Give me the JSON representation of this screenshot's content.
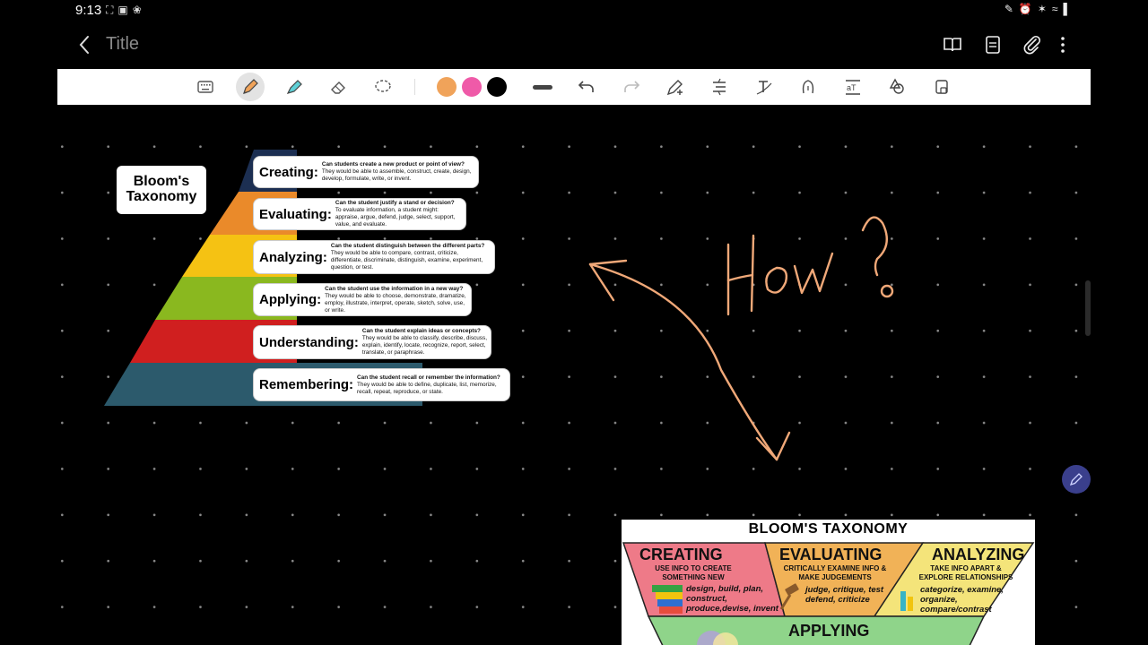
{
  "status": {
    "time": "9:13",
    "left_icons": [
      "⛶",
      "▣",
      "❀"
    ],
    "right_icons": [
      "✎",
      "⏰",
      "✶",
      "≈",
      "▌"
    ]
  },
  "app_bar": {
    "title": "Title",
    "actions": [
      "book-icon",
      "page-view-icon",
      "attach-icon",
      "more-icon"
    ]
  },
  "toolbar": {
    "tools": [
      "keyboard-icon",
      "pen-icon",
      "highlighter-icon",
      "eraser-icon",
      "lasso-icon"
    ],
    "colors": [
      "#f0a35a",
      "#ef5aa8",
      "#000000"
    ],
    "selected_tool": "pen-icon"
  },
  "pyramid": {
    "title_line1": "Bloom's",
    "title_line2": "Taxonomy",
    "levels": [
      {
        "name": "Creating:",
        "color": "#1c2f52",
        "question": "Can students create a new product or point of view?",
        "desc": "They would be able to assemble, construct, create, design, develop, formulate, write, or invent."
      },
      {
        "name": "Evaluating:",
        "color": "#ea8a2a",
        "question": "Can the student justify a stand or decision?",
        "desc": "To evaluate information, a student might: appraise, argue, defend, judge, select, support, value, and evaluate."
      },
      {
        "name": "Analyzing:",
        "color": "#f5c213",
        "question": "Can the student distinguish between the different parts?",
        "desc": "They would be able to compare, contrast, criticize, differentiate, discriminate, distinguish, examine, experiment, question, or test."
      },
      {
        "name": "Applying:",
        "color": "#8ab81f",
        "question": "Can the student use the information in a new way?",
        "desc": "They would be able to choose, demonstrate, dramatize, employ, illustrate, interpret, operate, sketch, solve, use, or write."
      },
      {
        "name": "Understanding:",
        "color": "#d01f1f",
        "question": "Can the student explain ideas or concepts?",
        "desc": "They would be able to classify, describe, discuss, explain, identify, locate, recognize, report, select, translate, or paraphrase."
      },
      {
        "name": "Remembering:",
        "color": "#2c5a6c",
        "question": "Can the student recall or remember the information?",
        "desc": "They would be able to define, duplicate, list, memorize, recall, repeat, reproduce, or state."
      }
    ]
  },
  "handwriting": {
    "text": "How?",
    "ink_color": "#f0a878"
  },
  "poster": {
    "title": "BLOOM'S TAXONOMY",
    "creating": {
      "head": "CREATING",
      "sub": "USE INFO TO CREATE SOMETHING NEW",
      "words": "design, build, plan, construct, produce,devise, invent"
    },
    "evaluating": {
      "head": "EVALUATING",
      "sub": "CRITICALLY EXAMINE INFO & MAKE JUDGEMENTS",
      "words": "judge, critique, test defend, criticize"
    },
    "analyzing": {
      "head": "ANALYZING",
      "sub": "TAKE INFO APART & EXPLORE RELATIONSHIPS",
      "words": "categorize, examine, organize, compare/contrast"
    },
    "applying": {
      "head": "APPLYING"
    }
  }
}
